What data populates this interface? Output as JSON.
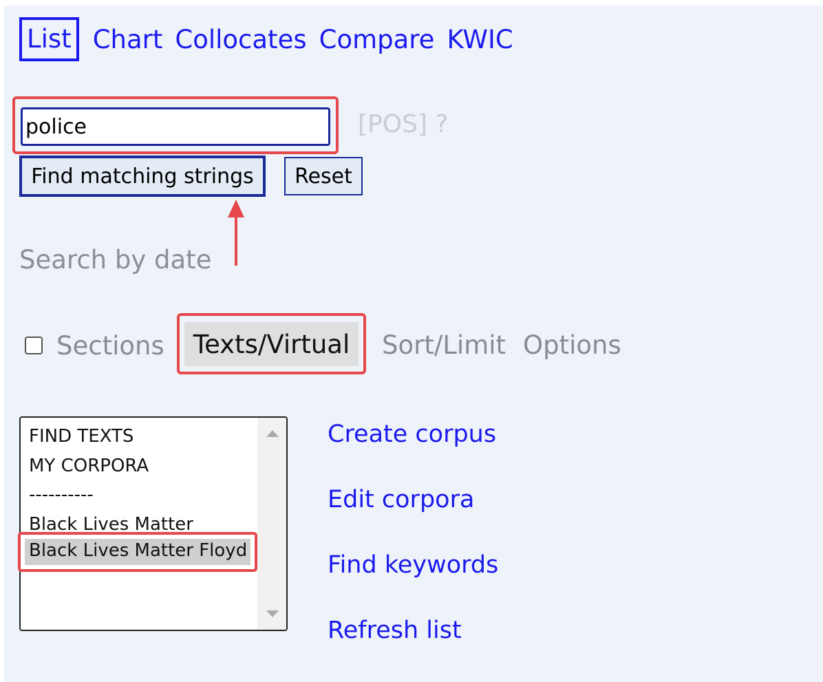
{
  "tabs": [
    {
      "label": "List",
      "active": true
    },
    {
      "label": "Chart"
    },
    {
      "label": "Collocates"
    },
    {
      "label": "Compare"
    },
    {
      "label": "KWIC"
    }
  ],
  "search": {
    "value": "police"
  },
  "pos_label": "[POS] ?",
  "buttons": {
    "find": "Find matching strings",
    "reset": "Reset"
  },
  "search_by_date": "Search by date",
  "options": {
    "sections": "Sections",
    "texts_virtual": "Texts/Virtual",
    "sort_limit": "Sort/Limit",
    "options": "Options"
  },
  "corpus_list": {
    "items": [
      "FIND TEXTS",
      "MY CORPORA",
      "----------",
      "Black Lives Matter",
      "Black Lives Matter Floyd"
    ],
    "selected": "Black Lives Matter Floyd"
  },
  "links": [
    "Create corpus",
    "Edit corpora",
    "Find keywords",
    "Refresh list"
  ],
  "colors": {
    "link": "#1a1aee",
    "highlight": "#e5484d",
    "panel_bg": "#eef2f9"
  }
}
